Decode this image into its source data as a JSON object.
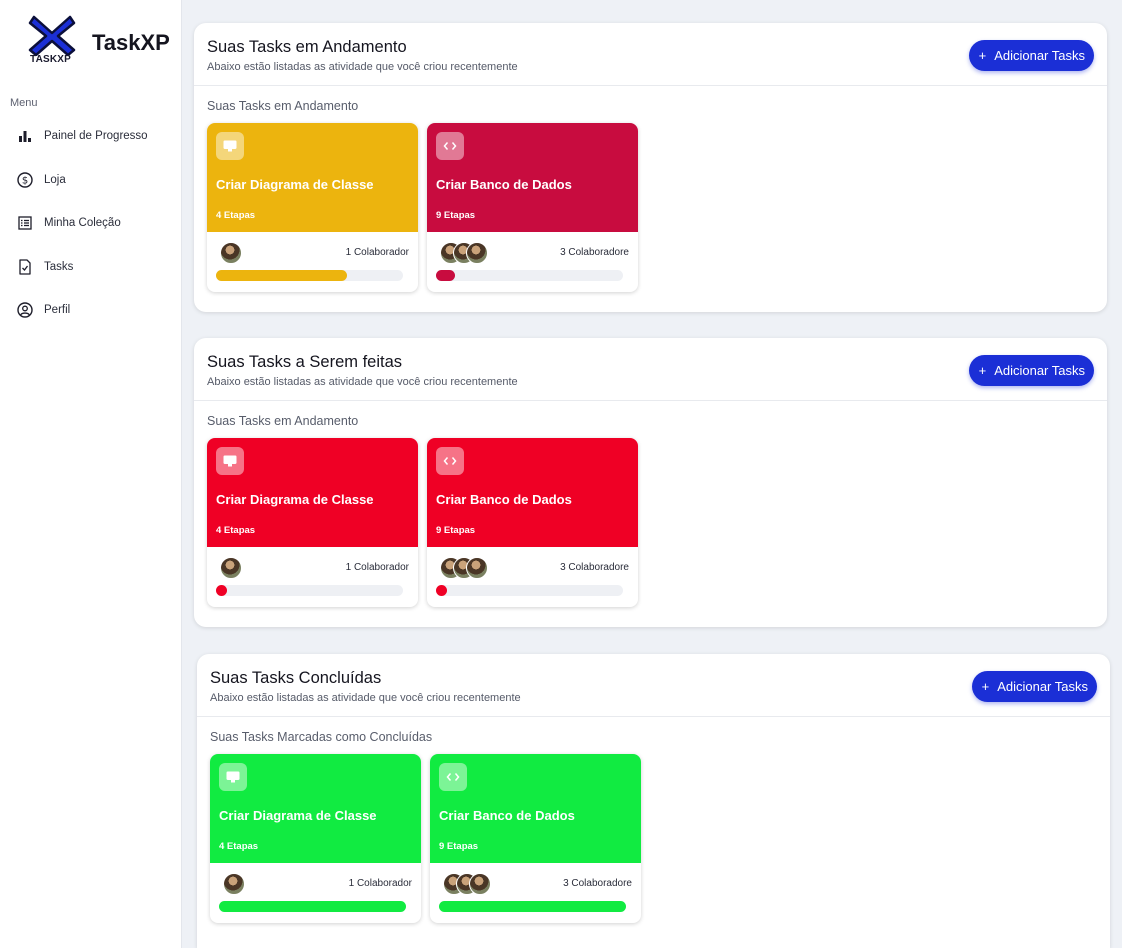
{
  "app": {
    "brand": "TaskXP",
    "logo_text": "TASKXP"
  },
  "colors": {
    "accent": "#1b2fd6",
    "yellow": "#ecb40e",
    "crimson": "#c80c3f",
    "red": "#ef0025",
    "green": "#11eb41"
  },
  "sidebar": {
    "menu_label": "Menu",
    "items": [
      {
        "label": "Painel de Progresso",
        "icon": "bar-chart-icon"
      },
      {
        "label": "Loja",
        "icon": "dollar-circle-icon"
      },
      {
        "label": "Minha Coleção",
        "icon": "list-icon"
      },
      {
        "label": "Tasks",
        "icon": "document-check-icon"
      },
      {
        "label": "Perfil",
        "icon": "user-circle-icon"
      }
    ]
  },
  "sections": [
    {
      "title": "Suas Tasks em Andamento",
      "subtitle": "Abaixo estão listadas as atividade que você criou recentemente",
      "button_label": "Adicionar Tasks",
      "caption": "Suas Tasks em Andamento",
      "cards": [
        {
          "title": "Criar Diagrama de Classe",
          "steps": "4 Etapas",
          "collaborators": "1 Colaborador",
          "avatar_count": 1,
          "icon": "monitor-icon",
          "color": "#ecb40e",
          "progress": 0.7
        },
        {
          "title": "Criar Banco de Dados",
          "steps": "9 Etapas",
          "collaborators": "3 Colaboradore",
          "avatar_count": 3,
          "icon": "code-icon",
          "color": "#c80c3f",
          "progress": 0.1
        }
      ]
    },
    {
      "title": "Suas Tasks a Serem feitas",
      "subtitle": "Abaixo estão listadas as atividade que você criou recentemente",
      "button_label": "Adicionar Tasks",
      "caption": "Suas Tasks em Andamento",
      "cards": [
        {
          "title": "Criar Diagrama de Classe",
          "steps": "4 Etapas",
          "collaborators": "1 Colaborador",
          "avatar_count": 1,
          "icon": "monitor-icon",
          "color": "#ef0025",
          "progress": 0.05
        },
        {
          "title": "Criar Banco de Dados",
          "steps": "9 Etapas",
          "collaborators": "3 Colaboradore",
          "avatar_count": 3,
          "icon": "code-icon",
          "color": "#ef0025",
          "progress": 0.05
        }
      ]
    },
    {
      "title": "Suas Tasks Concluídas",
      "subtitle": "Abaixo estão listadas as atividade que você criou recentemente",
      "button_label": "Adicionar Tasks",
      "caption": "Suas Tasks Marcadas como Concluídas",
      "cards": [
        {
          "title": "Criar Diagrama de Classe",
          "steps": "4 Etapas",
          "collaborators": "1 Colaborador",
          "avatar_count": 1,
          "icon": "monitor-icon",
          "color": "#11eb41",
          "progress": 1.0
        },
        {
          "title": "Criar Banco de Dados",
          "steps": "9 Etapas",
          "collaborators": "3 Colaboradore",
          "avatar_count": 3,
          "icon": "code-icon",
          "color": "#11eb41",
          "progress": 1.0
        }
      ]
    }
  ]
}
